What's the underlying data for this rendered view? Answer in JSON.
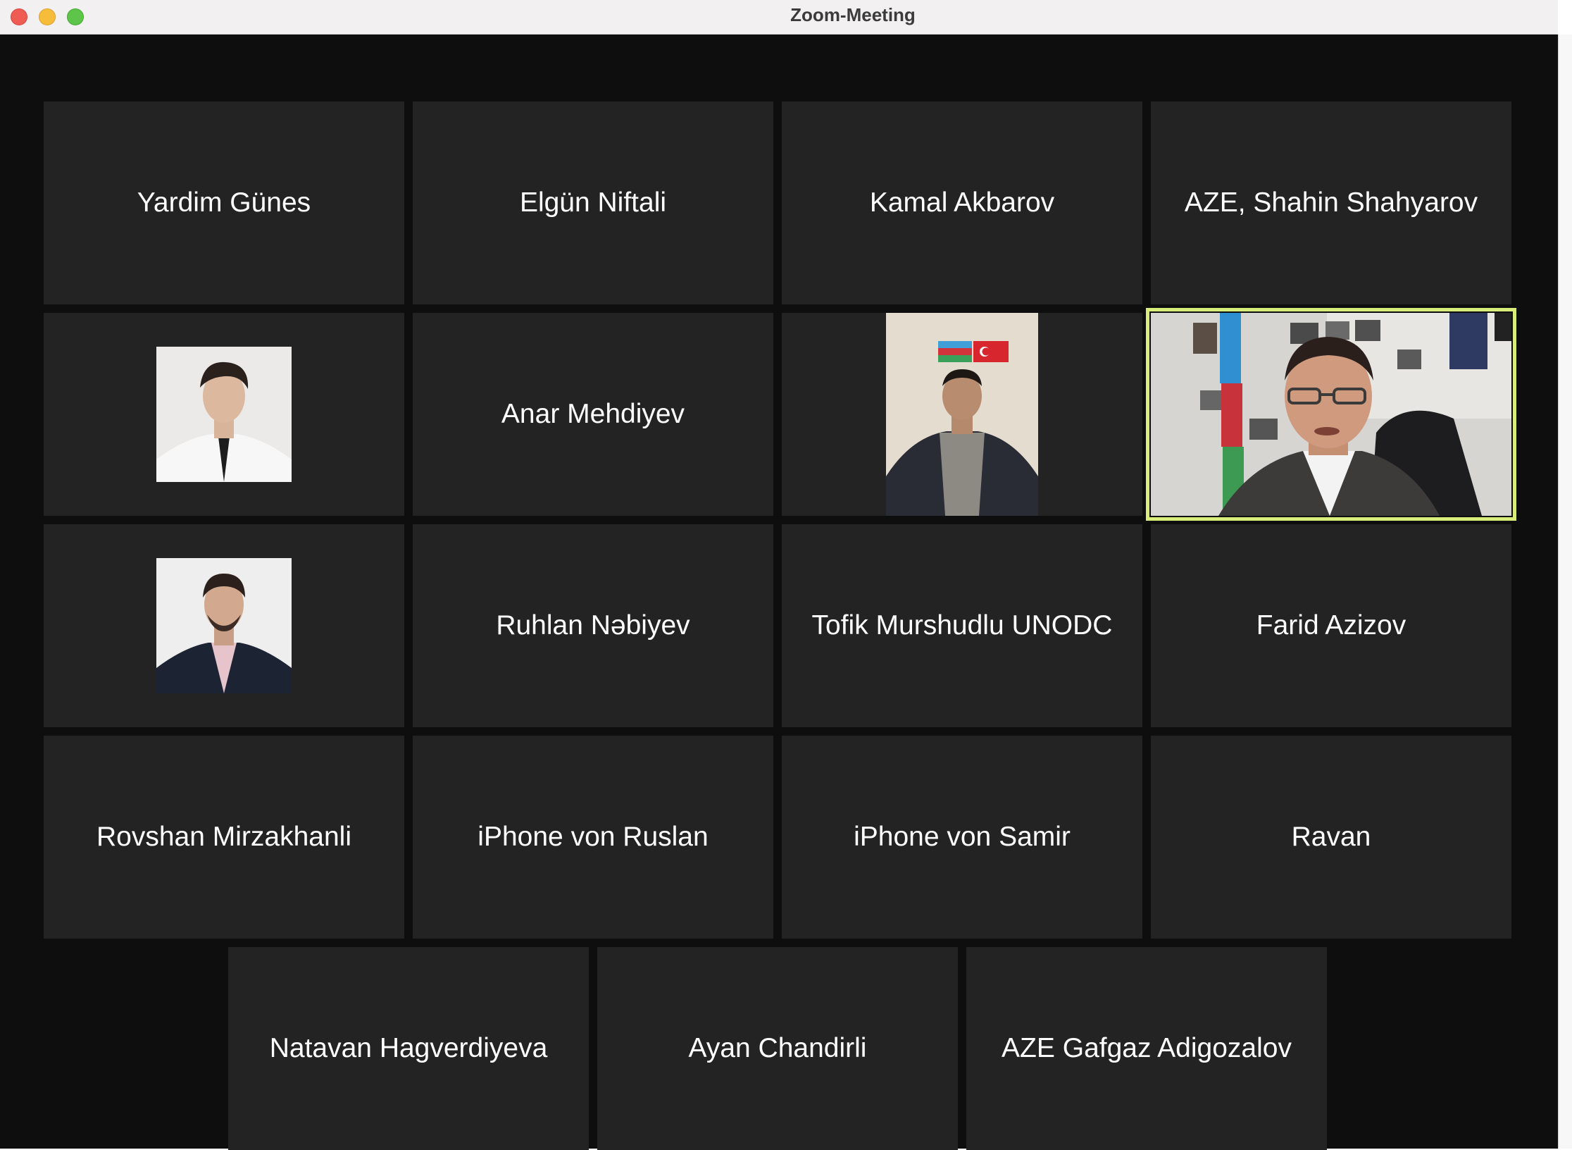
{
  "window": {
    "title": "Zoom-Meeting"
  },
  "participants": [
    {
      "name": "Yardim Günes"
    },
    {
      "name": "Elgün Niftali"
    },
    {
      "name": "Kamal Akbarov"
    },
    {
      "name": "AZE, Shahin Shahyarov"
    },
    {
      "name": "",
      "view": "profile-photo"
    },
    {
      "name": "Anar Mehdiyev"
    },
    {
      "name": "",
      "view": "video"
    },
    {
      "name": "",
      "view": "video",
      "active_speaker": true
    },
    {
      "name": "",
      "view": "profile-photo"
    },
    {
      "name": "Ruhlan Nəbiyev"
    },
    {
      "name": "Tofik Murshudlu UNODC"
    },
    {
      "name": "Farid Azizov"
    },
    {
      "name": "Rovshan Mirzakhanli"
    },
    {
      "name": "iPhone von Ruslan"
    },
    {
      "name": "iPhone von Samir"
    },
    {
      "name": "Ravan"
    },
    {
      "name": "Natavan Hagverdiyeva"
    },
    {
      "name": "Ayan Chandirli"
    },
    {
      "name": "AZE Gafgaz Adigozalov"
    }
  ],
  "colors": {
    "stage": "#0e0e0e",
    "tile": "#232323",
    "active_speaker_border": "#d9ee7a"
  }
}
